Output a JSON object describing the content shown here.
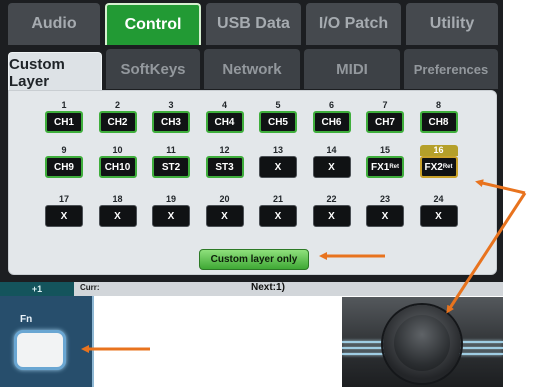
{
  "top_tabs": [
    "Audio",
    "Control",
    "USB Data",
    "I/O Patch",
    "Utility"
  ],
  "sub_tabs": [
    "Custom Layer",
    "SoftKeys",
    "Network",
    "MIDI",
    "Preferences"
  ],
  "channels": [
    {
      "num": "1",
      "label": "CH1"
    },
    {
      "num": "2",
      "label": "CH2"
    },
    {
      "num": "3",
      "label": "CH3"
    },
    {
      "num": "4",
      "label": "CH4"
    },
    {
      "num": "5",
      "label": "CH5"
    },
    {
      "num": "6",
      "label": "CH6"
    },
    {
      "num": "7",
      "label": "CH7"
    },
    {
      "num": "8",
      "label": "CH8"
    },
    {
      "num": "9",
      "label": "CH9"
    },
    {
      "num": "10",
      "label": "CH10"
    },
    {
      "num": "11",
      "label": "ST2"
    },
    {
      "num": "12",
      "label": "ST3"
    },
    {
      "num": "13",
      "label": "X"
    },
    {
      "num": "14",
      "label": "X"
    },
    {
      "num": "15",
      "label": "FX1",
      "suffix": "Ret"
    },
    {
      "num": "16",
      "label": "FX2",
      "suffix": "Ret"
    },
    {
      "num": "17",
      "label": "X"
    },
    {
      "num": "18",
      "label": "X"
    },
    {
      "num": "19",
      "label": "X"
    },
    {
      "num": "20",
      "label": "X"
    },
    {
      "num": "21",
      "label": "X"
    },
    {
      "num": "22",
      "label": "X"
    },
    {
      "num": "23",
      "label": "X"
    },
    {
      "num": "24",
      "label": "X"
    }
  ],
  "custom_only_label": "Custom layer only",
  "status": {
    "layer": "+1",
    "curr": "Curr:",
    "next": "Next:1)"
  },
  "fn": {
    "label": "Fn"
  },
  "colors": {
    "active_tab": "#229a34",
    "assigned_border": "#3fae3c",
    "selected_highlight": "#b5a02a",
    "arrow": "#e8731e"
  }
}
